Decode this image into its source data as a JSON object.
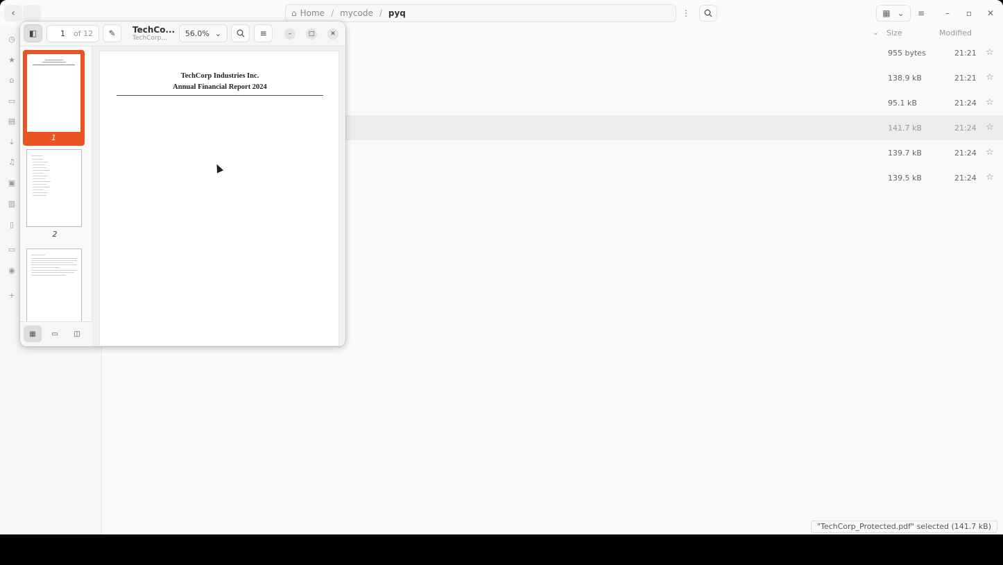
{
  "files": {
    "path": [
      {
        "label": "Home"
      },
      {
        "label": "mycode"
      },
      {
        "label": "pyq"
      }
    ],
    "columns": {
      "size": "Size",
      "modified": "Modified"
    },
    "rows": [
      {
        "size": "955 bytes",
        "modified": "21:21",
        "selected": false
      },
      {
        "size": "138.9 kB",
        "modified": "21:21",
        "selected": false
      },
      {
        "size": "95.1 kB",
        "modified": "21:24",
        "selected": false
      },
      {
        "size": "141.7 kB",
        "modified": "21:24",
        "selected": true
      },
      {
        "size": "139.7 kB",
        "modified": "21:24",
        "selected": false
      },
      {
        "size": "139.5 kB",
        "modified": "21:24",
        "selected": false
      }
    ],
    "status": "\"TechCorp_Protected.pdf\" selected  (141.7 kB)"
  },
  "viewer": {
    "page_current": "1",
    "page_total": "of 12",
    "title": "TechCo...",
    "subtitle": "TechCorp...",
    "zoom": "56.0%",
    "thumbnails": [
      {
        "label": "1",
        "selected": true
      },
      {
        "label": "2",
        "selected": false
      }
    ],
    "document": {
      "line1": "TechCorp Industries Inc.",
      "line2": "Annual Financial Report 2024"
    }
  },
  "colors": {
    "accent": "#e95420"
  }
}
